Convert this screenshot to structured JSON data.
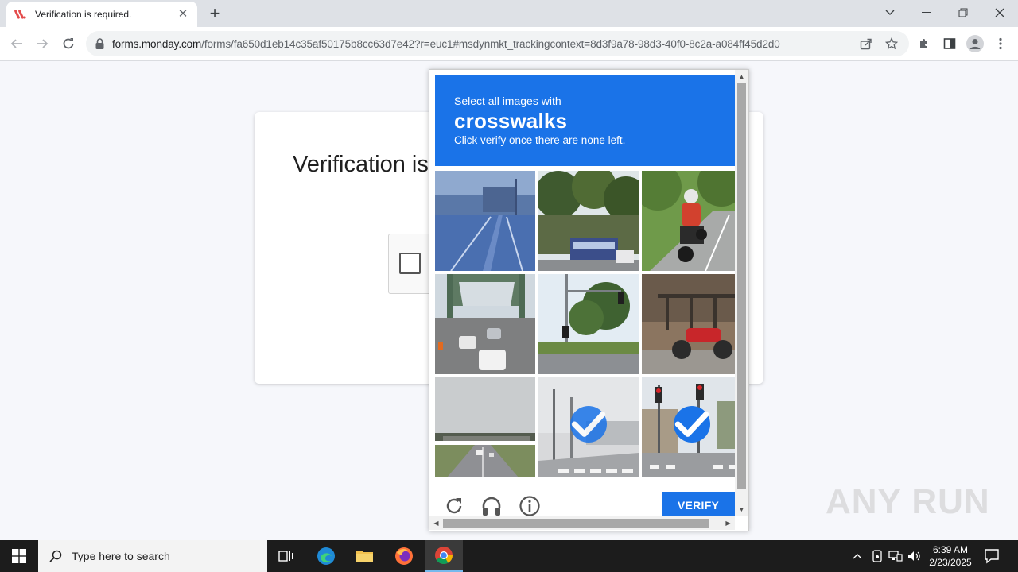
{
  "browser": {
    "tab_title": "Verification is required.",
    "url_host": "forms.monday.com",
    "url_path": "/forms/fa650d1eb14c35af50175b8cc63d7e42?r=euc1#msdynmkt_trackingcontext=8d3f9a78-98d3-40f0-8c2a-a084ff45d2d0"
  },
  "page": {
    "title": "Verification is required."
  },
  "challenge": {
    "lead": "Select all images with",
    "keyword": "crosswalks",
    "instruction": "Click verify once there are none left.",
    "verify_label": "VERIFY",
    "tiles": [
      {
        "scene": "highway-blue",
        "selected": false
      },
      {
        "scene": "bus-trees",
        "selected": false
      },
      {
        "scene": "motorcycle-rider",
        "selected": false
      },
      {
        "scene": "bridge-traffic",
        "selected": false
      },
      {
        "scene": "traffic-light-tree",
        "selected": false
      },
      {
        "scene": "parked-motorbike",
        "selected": false
      },
      {
        "scene": "overpass-highway",
        "selected": false
      },
      {
        "scene": "crosswalk-pole",
        "selected": true
      },
      {
        "scene": "crosswalk-signal",
        "selected": true
      }
    ],
    "accent": "#1a73e8"
  },
  "watermark": "ANY RUN",
  "taskbar": {
    "search_placeholder": "Type here to search",
    "time": "6:39 AM",
    "date": "2/23/2025"
  }
}
